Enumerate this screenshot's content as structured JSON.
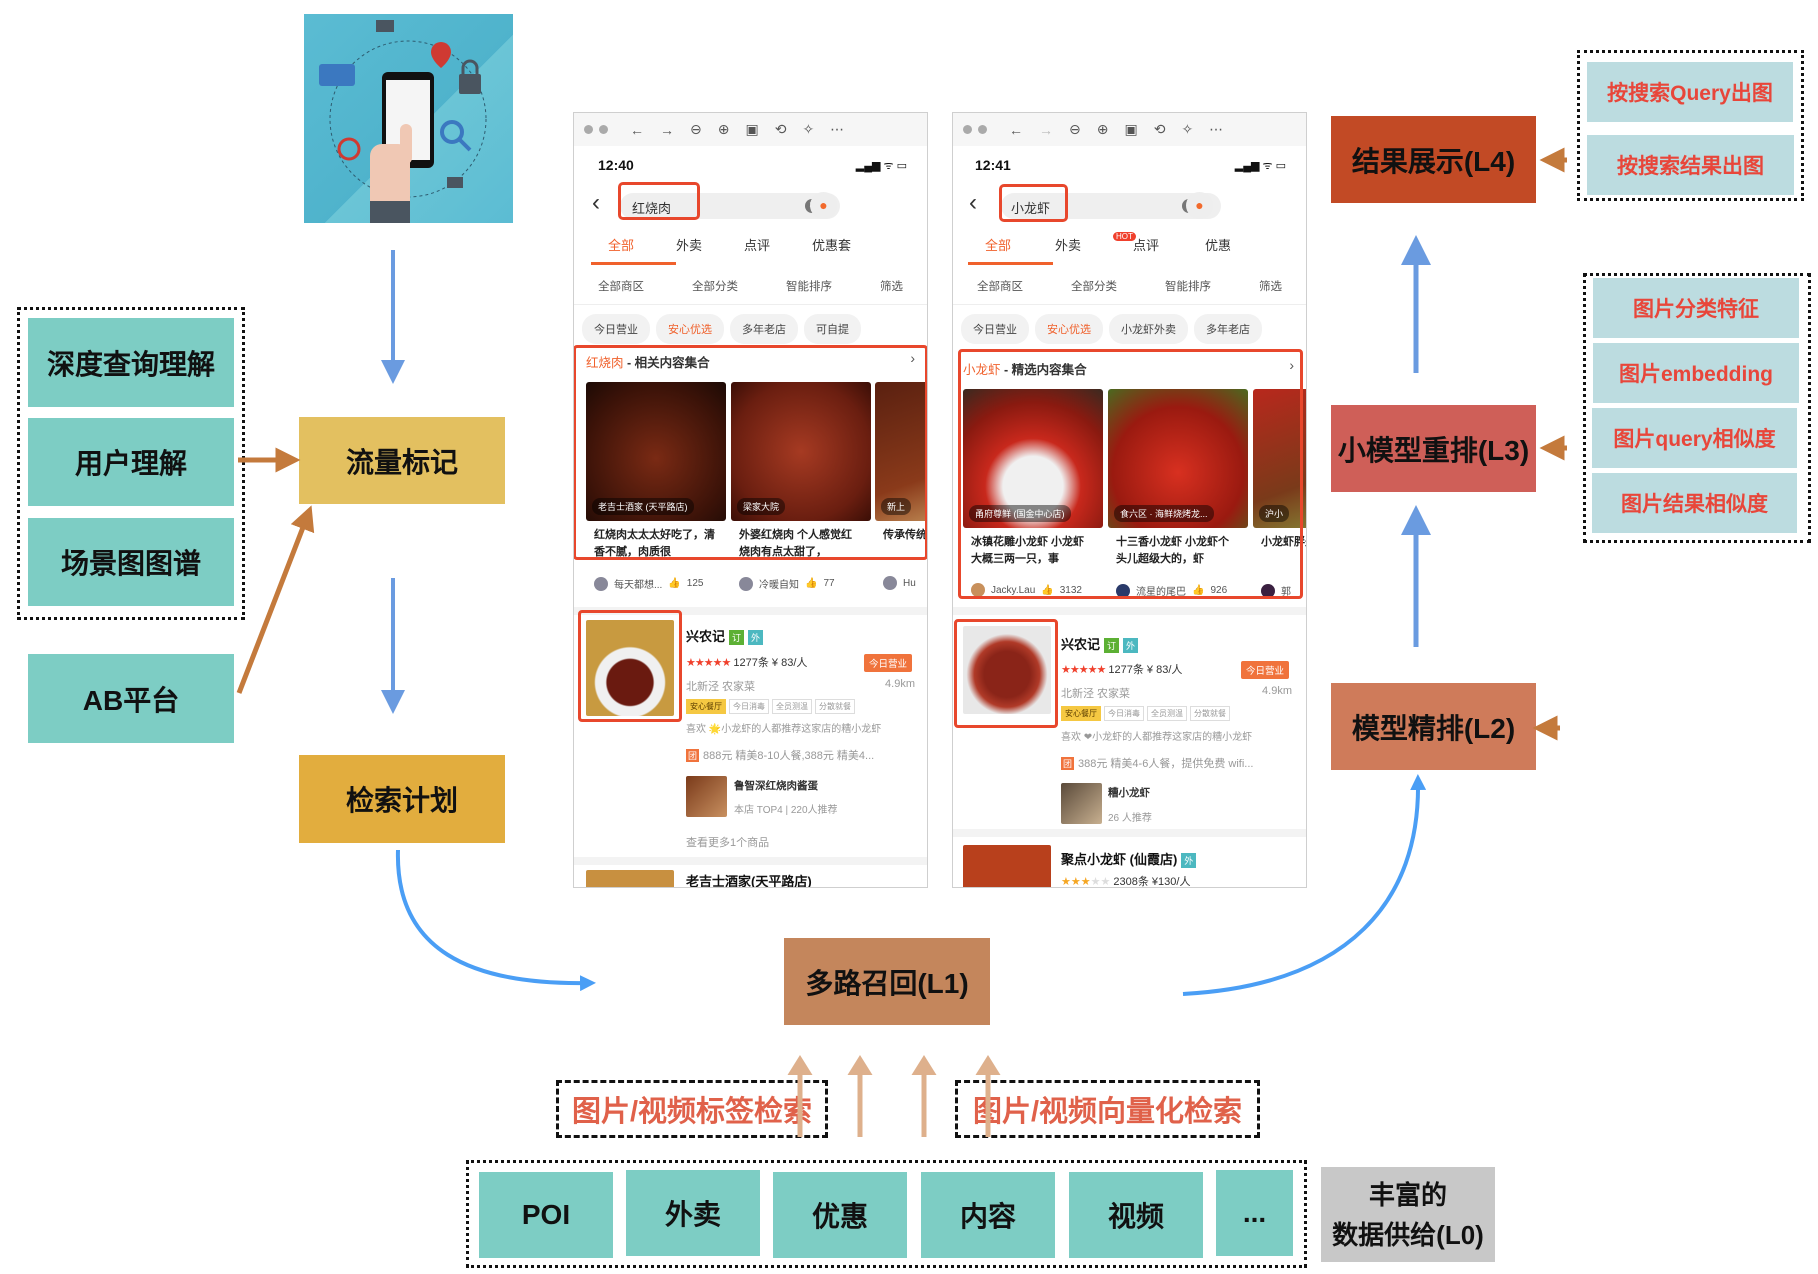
{
  "left": {
    "group_items": [
      "深度查询理解",
      "用户理解",
      "场景图图谱"
    ],
    "ab_platform": "AB平台",
    "traffic_tag": "流量标记",
    "retrieval_plan": "检索计划"
  },
  "center": {
    "recall": "多路召回(L1)",
    "tag_retrieval": "图片/视频标签检索",
    "vector_retrieval": "图片/视频向量化检索",
    "sources": [
      "POI",
      "外卖",
      "优惠",
      "内容",
      "视频",
      "..."
    ],
    "supply_label_line1": "丰富的",
    "supply_label_line2": "数据供给(L0)"
  },
  "right": {
    "l4": "结果展示(L4)",
    "l3": "小模型重排(L3)",
    "l2": "模型精排(L2)",
    "l4_features": [
      "按搜索Query出图",
      "按搜索结果出图"
    ],
    "l3_features": [
      "图片分类特征",
      "图片embedding",
      "图片query相似度",
      "图片结果相似度"
    ]
  },
  "colors": {
    "teal": "#7dcdc4",
    "yellow_light": "#e3c060",
    "yellow_dark": "#e2ad3e",
    "recall_brown": "#c4865c",
    "l4_red": "#c24a25",
    "l3_red": "#cf5f58",
    "l2_orange": "#cf7b5a",
    "feature_bg": "#bcdce0",
    "feature_text": "#e8463a",
    "arrow_blue": "#6a9be0",
    "arrow_orange": "#c47a3c",
    "highlight_red": "#e8472c"
  },
  "phones": [
    {
      "time": "12:40",
      "search_query": "红烧肉",
      "tabs": [
        "全部",
        "外卖",
        "点评",
        "优惠套"
      ],
      "filters": [
        "全部商区",
        "全部分类",
        "智能排序",
        "筛选"
      ],
      "chips": [
        "今日营业",
        "安心优选",
        "多年老店",
        "可自提"
      ],
      "section_keyword": "红烧肉",
      "section_title": " - 相关内容集合",
      "cards": [
        {
          "pin": "老吉士酒家 (天平路店)",
          "caption": "红烧肉太太太好吃了，清香不腻，肉质很",
          "author": "每天都想...",
          "likes": "125"
        },
        {
          "pin": "梁家大院",
          "caption": "外婆红烧肉 个人感觉红烧肉有点太甜了，",
          "author": "冷暖自知",
          "likes": "77"
        },
        {
          "pin": "新上",
          "caption": "传承传统做法，",
          "author": "Hu",
          "likes": ""
        }
      ],
      "listing": {
        "name": "兴农记",
        "tag1": "订",
        "tag2": "外",
        "reviews": "1277条",
        "price": "¥ 83/人",
        "open_badge": "今日营业",
        "area": "北新泾 农家菜",
        "distance": "4.9km",
        "tags": [
          "安心餐厅",
          "今日消毒",
          "全员测温",
          "分散就餐"
        ],
        "recommend": "喜欢 🌟小龙虾的人都推荐这家店的糟小龙虾",
        "deal_icon": "团",
        "deal": "888元 精美8-10人餐,388元 精美4...",
        "product_name": "鲁智深红烧肉酱蛋",
        "product_meta": "本店 TOP4 | 220人推荐",
        "more": "查看更多1个商品",
        "next_name": "老吉士酒家(天平路店)"
      }
    },
    {
      "time": "12:41",
      "search_query": "小龙虾",
      "tabs": [
        "全部",
        "外卖",
        "点评",
        "优惠"
      ],
      "hot_badge": "HOT",
      "filters": [
        "全部商区",
        "全部分类",
        "智能排序",
        "筛选"
      ],
      "chips": [
        "今日营业",
        "安心优选",
        "小龙虾外卖",
        "多年老店"
      ],
      "section_keyword": "小龙虾",
      "section_title": " - 精选内容集合",
      "cards": [
        {
          "pin": "甬府尊鲜 (国金中心店)",
          "caption": "冰镇花雕小龙虾 小龙虾大概三两一只，事",
          "author": "Jacky.Lau",
          "likes": "3132"
        },
        {
          "pin": "食六区 · 海鲜烧烤龙...",
          "caption": "十三香小龙虾 小龙虾个头儿超级大的，虾",
          "author": "流星的尾巴",
          "likes": "926"
        },
        {
          "pin": "沪小",
          "caption": "小龙虾胖是出",
          "author": "郭",
          "likes": ""
        }
      ],
      "listing": {
        "name": "兴农记",
        "tag1": "订",
        "tag2": "外",
        "reviews": "1277条",
        "price": "¥ 83/人",
        "open_badge": "今日营业",
        "area": "北新泾 农家菜",
        "distance": "4.9km",
        "tags": [
          "安心餐厅",
          "今日消毒",
          "全员测温",
          "分散就餐"
        ],
        "recommend": "喜欢 ❤小龙虾的人都推荐这家店的糟小龙虾",
        "deal_icon": "团",
        "deal": "388元 精美4-6人餐，提供免费 wifi...",
        "product_name": "糟小龙虾",
        "product_meta": "26 人推荐",
        "next_name": "聚点小龙虾 (仙霞店)",
        "next_tag": "外",
        "next_meta": "2308条 ¥130/人"
      }
    }
  ]
}
